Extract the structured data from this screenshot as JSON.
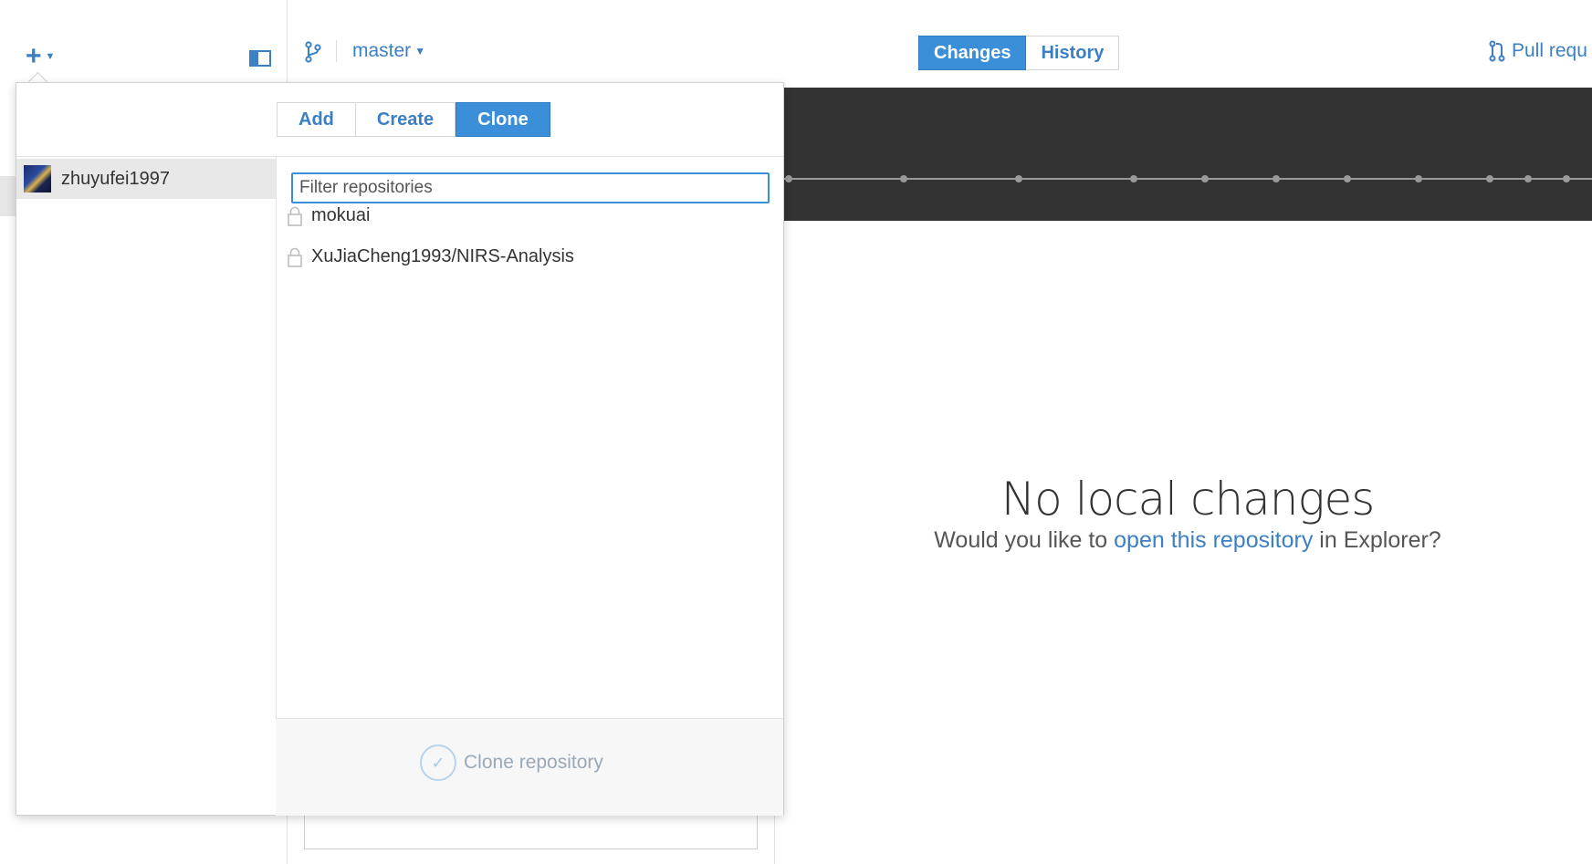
{
  "toolbar": {
    "add_icon": "plus-icon",
    "branch": "master",
    "tabs": [
      {
        "label": "Changes",
        "active": true
      },
      {
        "label": "History",
        "active": false
      }
    ],
    "pull_request_label": "Pull requ"
  },
  "popover": {
    "modes": [
      "Add",
      "Create",
      "Clone"
    ],
    "active_mode": "Clone",
    "account": "zhuyufei1997",
    "filter": {
      "placeholder": "Filter repositories",
      "value": ""
    },
    "repos": [
      {
        "name": "mokuai",
        "icon": "lock-icon"
      },
      {
        "name": "XuJiaCheng1993/NIRS-Analysis",
        "icon": "lock-icon"
      }
    ],
    "clone_button_label": "Clone repository"
  },
  "main": {
    "empty_title": "No local changes",
    "empty_prefix": "Would you like to",
    "empty_link": "open this repository",
    "empty_suffix": "in Explorer?"
  },
  "colors": {
    "accent": "#3b8fd9",
    "link": "#3b7fc4",
    "banner": "#333333"
  }
}
